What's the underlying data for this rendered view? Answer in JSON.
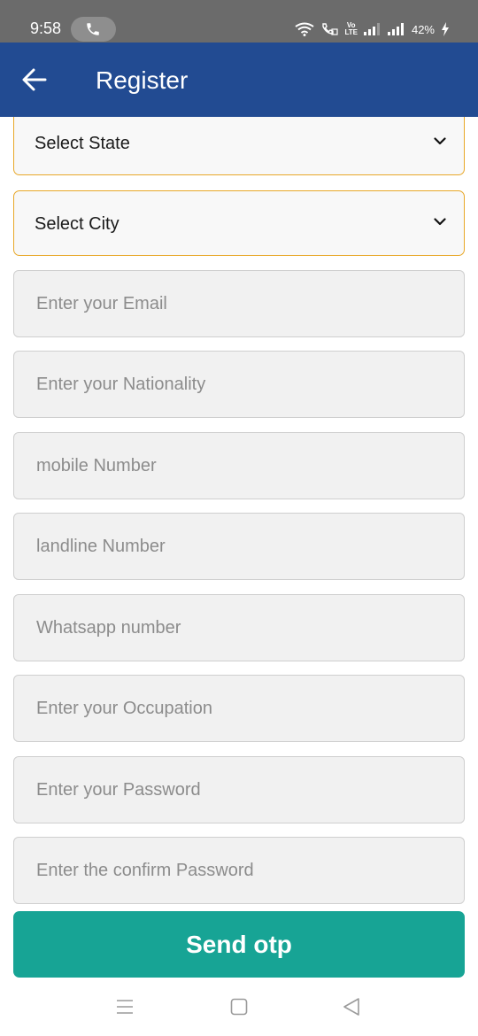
{
  "status_bar": {
    "time": "9:58",
    "lte_line1": "Vo",
    "lte_line2": "LTE",
    "battery": "42%"
  },
  "app_bar": {
    "title": "Register"
  },
  "form": {
    "state_select": {
      "value": "Select State"
    },
    "city_select": {
      "value": "Select City"
    },
    "email": {
      "placeholder": "Enter your Email"
    },
    "nationality": {
      "placeholder": "Enter your Nationality"
    },
    "mobile": {
      "placeholder": "mobile Number"
    },
    "landline": {
      "placeholder": "landline Number"
    },
    "whatsapp": {
      "placeholder": "Whatsapp number"
    },
    "occupation": {
      "placeholder": "Enter your Occupation"
    },
    "password": {
      "placeholder": "Enter your Password"
    },
    "confirm_password": {
      "placeholder": "Enter the confirm Password"
    },
    "send_button": "Send otp"
  },
  "colors": {
    "app_bar": "#224b92",
    "select_border": "#e8a829",
    "button": "#17a495"
  }
}
